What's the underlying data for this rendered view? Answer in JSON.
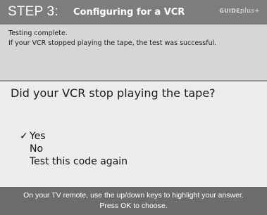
{
  "header": {
    "step": "STEP 3:",
    "title": "Configuring for a VCR",
    "logo_text": "GUIDE",
    "logo_plus": "plus+"
  },
  "status": {
    "line1": "Testing complete.",
    "line2": "If your VCR stopped playing the tape, the test was successful."
  },
  "question": "Did your VCR stop playing the tape?",
  "options": [
    {
      "label": "Yes",
      "selected": true,
      "check": "✓"
    },
    {
      "label": "No",
      "selected": false,
      "check": ""
    },
    {
      "label": "Test this code again",
      "selected": false,
      "check": ""
    }
  ],
  "footer": {
    "line1": "On your TV remote, use the up/down keys to highlight your answer.",
    "line2": "Press OK to choose."
  },
  "colors": {
    "header_bg": "#7d7d7d",
    "info_bg": "#d6d6d6",
    "main_bg": "#ececec",
    "footer_bg": "#6c6c6c"
  }
}
